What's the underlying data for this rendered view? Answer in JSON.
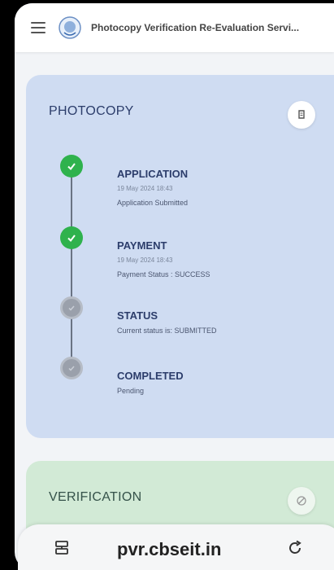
{
  "app": {
    "title": "Photocopy Verification Re-Evaluation Servi..."
  },
  "photocopy": {
    "title": "PHOTOCOPY",
    "steps": [
      {
        "name": "APPLICATION",
        "date": "19 May 2024 18:43",
        "desc": "Application Submitted",
        "state": "done"
      },
      {
        "name": "PAYMENT",
        "date": "19 May 2024 18:43",
        "desc": "Payment Status : SUCCESS",
        "state": "done"
      },
      {
        "name": "STATUS",
        "desc": "Current status is: SUBMITTED",
        "state": "pending"
      },
      {
        "name": "COMPLETED",
        "desc": "Pending",
        "state": "pending"
      }
    ]
  },
  "verification": {
    "title": "VERIFICATION"
  },
  "browser": {
    "url": "pvr.cbseit.in"
  },
  "colors": {
    "done": "#2fb24d",
    "pending": "#9aa0ab",
    "photocopy_card": "#cfdcf2",
    "verification_card": "#d2ead6"
  }
}
